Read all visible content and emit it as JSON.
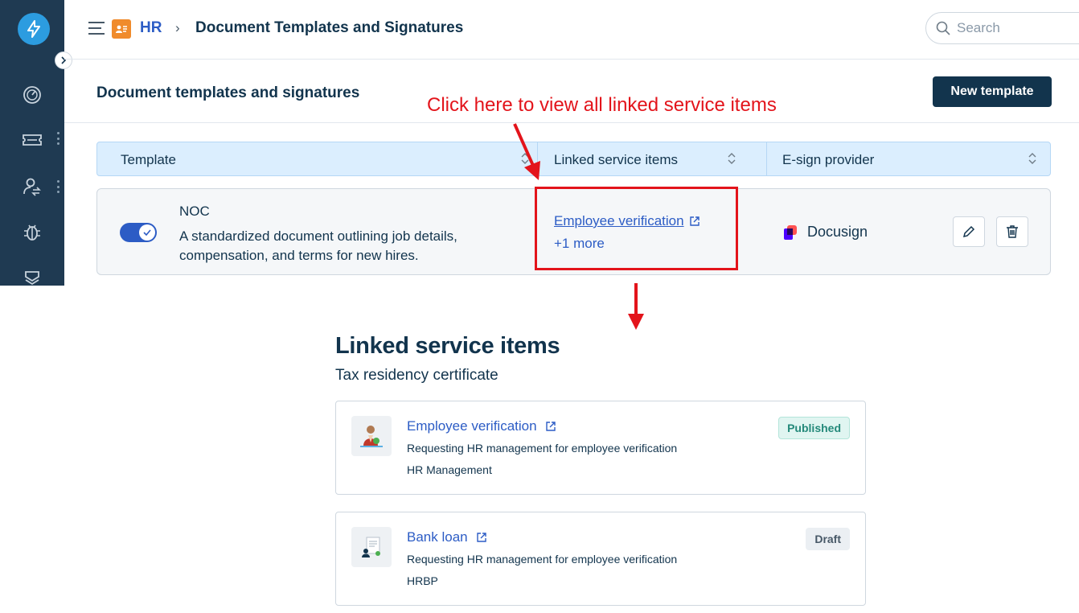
{
  "app": {
    "breadcrumb": {
      "module": "HR",
      "separator": "›",
      "current": "Document Templates and Signatures"
    },
    "search": {
      "placeholder": "Search"
    },
    "page_title": "Document templates and signatures",
    "new_template_label": "New template",
    "table": {
      "columns": [
        "Template",
        "Linked service items",
        "E-sign provider"
      ],
      "rows": [
        {
          "name": "NOC",
          "description": "A standardized document outlining job details, compensation, and terms for new hires.",
          "enabled": true,
          "linked_item": "Employee verification",
          "more_label": "+1 more",
          "provider": "Docusign"
        }
      ]
    }
  },
  "annotation": {
    "text": "Click here to view all linked service items",
    "color": "#e3141b"
  },
  "modal": {
    "title": "Linked service items",
    "subtitle": "Tax residency certificate",
    "items": [
      {
        "title": "Employee verification",
        "description": "Requesting HR management for employee verification",
        "category": "HR Management",
        "status": "Published"
      },
      {
        "title": "Bank loan",
        "description": "Requesting HR management for employee verification",
        "category": "HRBP",
        "status": "Draft"
      }
    ]
  },
  "colors": {
    "sidebar": "#1f3a52",
    "accent": "#2c5cc5",
    "primary_button": "#12344d",
    "annotation_red": "#e3141b",
    "header_row": "#dbeefe"
  }
}
